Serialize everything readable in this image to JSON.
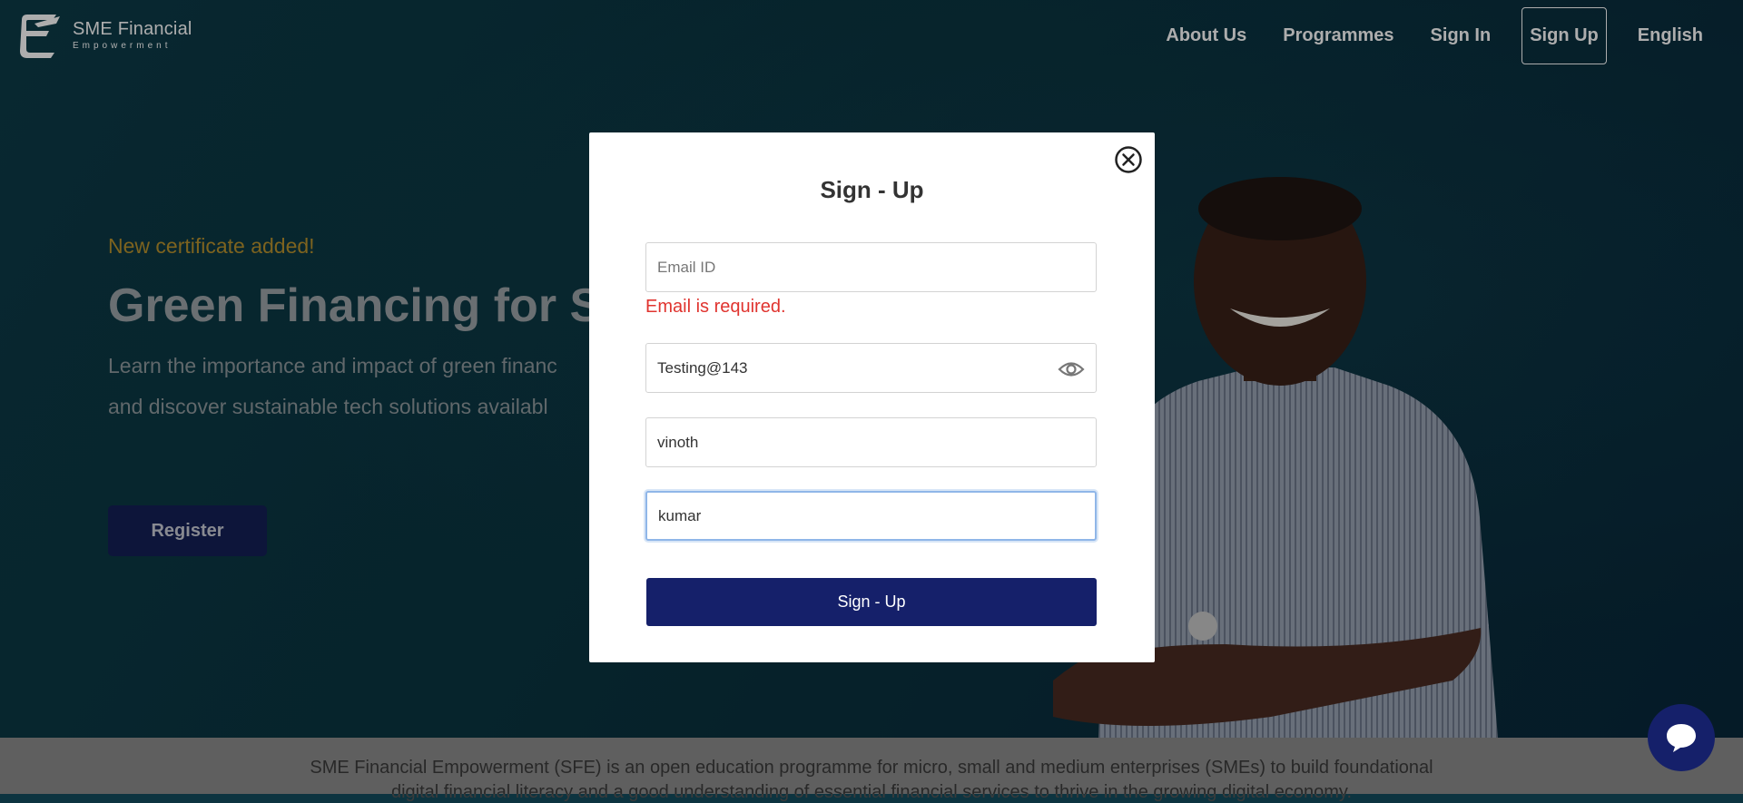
{
  "brand": {
    "title": "SME Financial",
    "subtitle": "Empowerment"
  },
  "nav": {
    "items": [
      {
        "label": "About Us"
      },
      {
        "label": "Programmes"
      },
      {
        "label": "Sign In"
      },
      {
        "label": "Sign Up"
      },
      {
        "label": "English"
      }
    ]
  },
  "hero": {
    "tag": "New certificate added!",
    "title": "Green Financing for SI",
    "text_line1": "Learn the importance and impact of green financ",
    "text_line2": "and discover sustainable tech solutions availabl",
    "register_label": "Register"
  },
  "modal": {
    "title": "Sign - Up",
    "email_placeholder": "Email ID",
    "email_error": "Email is required.",
    "password_value": "Testing@143",
    "first_name_value": "vinoth",
    "last_name_value": "kumar",
    "submit_label": "Sign - Up"
  },
  "footer": {
    "line1": "SME Financial Empowerment (SFE) is an open education programme for micro, small and medium enterprises (SMEs) to build foundational",
    "line2": "digital financial literacy and a good understanding of essential financial services to thrive in the growing digital economy."
  },
  "colors": {
    "primary": "#15206a",
    "error": "#e0342f",
    "accent": "#b8922e"
  },
  "icons": {
    "logo": "sfe-logo-icon",
    "close": "close-circle-icon",
    "eye": "eye-icon",
    "chat": "chat-bubble-icon"
  }
}
